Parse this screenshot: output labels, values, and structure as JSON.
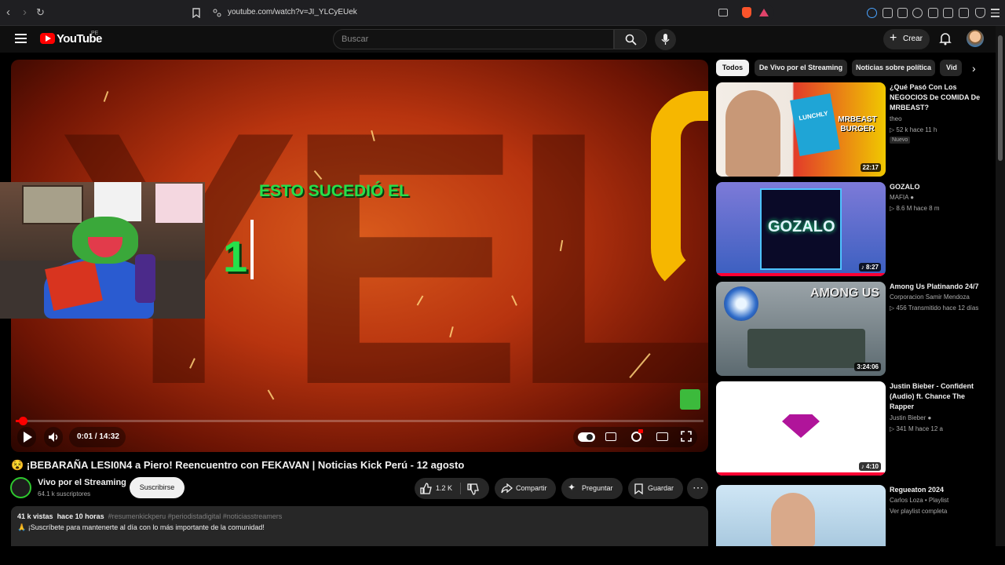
{
  "browser": {
    "url": "youtube.com/watch?v=JI_YLCyEUek"
  },
  "header": {
    "logo_text": "YouTube",
    "country": "PE",
    "search_placeholder": "Buscar",
    "create_label": "Crear"
  },
  "player": {
    "headline": "ESTO SUCEDIÓ EL",
    "big_number": "1",
    "time": "0:01 / 14:32",
    "progress": 0.001
  },
  "video": {
    "title": "¡BEBARAÑA LESI0N4 a Piero! Reencuentro con FEKAVAN | Noticias Kick Perú - 12 agosto",
    "title_prefix_emoji": "😵",
    "channel_name": "Vivo por el Streaming",
    "subscribers": "64.1 k suscriptores",
    "subscribe_label": "Suscribirse",
    "likes": "1.2 K",
    "share_label": "Compartir",
    "ask_label": "Preguntar",
    "save_label": "Guardar",
    "views": "41 k vistas",
    "age": "hace 10 horas",
    "hashtags": "#resumenkickperu #periodistadigital #noticiasstreamers",
    "description_line": "¡Suscríbete para mantenerte al día con lo más importante de la comunidad!"
  },
  "chips": [
    "Todos",
    "De Vivo por el Streaming",
    "Noticias sobre política",
    "Vid"
  ],
  "recommendations": [
    {
      "title": "¿Qué Pasó Con Los NEGOCIOS De COMIDA De MRBEAST?",
      "channel": "theo",
      "meta": "▷ 52 k  hace 11 h",
      "badge": "Nuevo",
      "duration": "22:17"
    },
    {
      "title": "GOZALO",
      "channel": "MAFIA",
      "meta": "▷ 8.6 M  hace 8 m",
      "duration": "8:27"
    },
    {
      "title": "Among Us Platinando 24/7",
      "channel": "Corporacion Samir Mendoza",
      "meta": "▷ 456  Transmitido hace 12 días",
      "duration": "3:24:06"
    },
    {
      "title": "Justin Bieber - Confident (Audio) ft. Chance The Rapper",
      "channel": "Justin Bieber",
      "meta": "▷ 341 M  hace 12 a",
      "duration": "4:10"
    },
    {
      "title": "Regueaton 2024",
      "channel": "Carlos Loza • Playlist",
      "meta": "Ver playlist completa",
      "duration": ""
    }
  ],
  "thumb_texts": {
    "gozalo": "GOZALO",
    "among": "AMONG US",
    "lunchly": "LUNCHLY",
    "burger": "MRBEAST BURGER"
  }
}
